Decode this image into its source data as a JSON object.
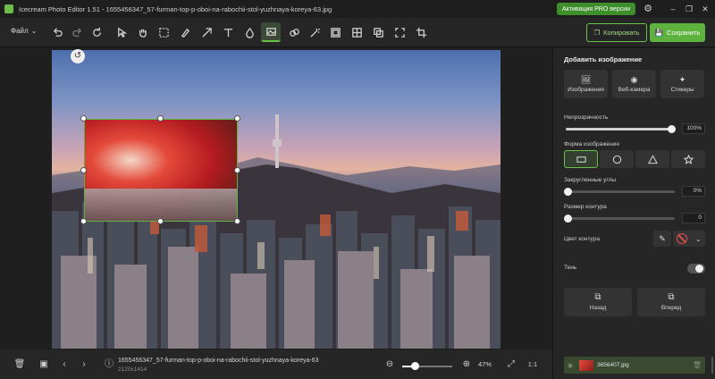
{
  "app": {
    "title": "Icecream Photo Editor 1.51 - 1655456347_57-furman-top-p-oboi-na-rabochii-stol-yuzhnaya-koreya-63.jpg",
    "pro_label": "Активация PRO версии",
    "window_controls": [
      "–",
      "❐",
      "✕"
    ]
  },
  "toolbar": {
    "file_menu": "Файл",
    "copy_label": "Копировать",
    "save_label": "Сохранить",
    "tools": [
      "undo",
      "redo",
      "rotate",
      "select",
      "hand",
      "rect-select",
      "brush",
      "arrow",
      "text",
      "drop",
      "add-image",
      "fill",
      "magic",
      "frame",
      "split",
      "copy-layer",
      "expand",
      "crop"
    ],
    "active_tool": "add-image",
    "accent_color": "#6cc04a"
  },
  "canvas": {
    "crop_icon": "↺"
  },
  "bottombar": {
    "file_name": "1655456347_57-furman-top-p-oboi-na-rabochii-stol-yuzhnaya-koreya-63",
    "dimensions": "2120x1414",
    "zoom": "47%",
    "fit_label": "⤢",
    "actual_label": "1:1"
  },
  "panel": {
    "title": "Добавить изображение",
    "sources": [
      {
        "label": "Изображения",
        "icon": "image-icon"
      },
      {
        "label": "Веб-камера",
        "icon": "webcam-icon"
      },
      {
        "label": "Стикеры",
        "icon": "sticker-icon"
      }
    ],
    "opacity_label": "Непрозрачность",
    "opacity_value": "100%",
    "opacity_fraction": 1.0,
    "shape_label": "Форма изображения",
    "corners_label": "Закругленные углы",
    "corners_value": "0%",
    "border_label": "Размер контура",
    "border_value": "0",
    "border_color_label": "Цвет контура",
    "shadow_label": "Тень",
    "back_label": "Назад",
    "forward_label": "Вперед",
    "layer_name": "3656407.jpg"
  }
}
